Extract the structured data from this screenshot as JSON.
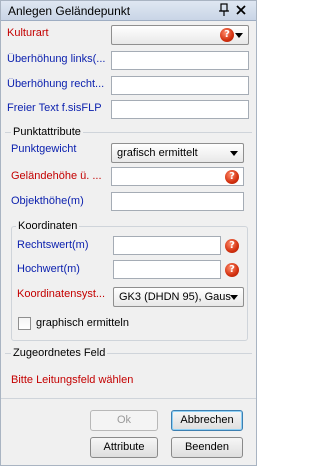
{
  "window": {
    "title": "Anlegen Geländepunkt"
  },
  "titlebar": {
    "pin_icon": "pin-icon",
    "close_icon": "close-icon"
  },
  "form": {
    "kulturart_label": "Kulturart",
    "kulturart_value": "",
    "ueberhoehung_links_label": "Überhöhung links(...",
    "ueberhoehung_links_value": "",
    "ueberhoehung_rechts_label": "Überhöhung recht...",
    "ueberhoehung_rechts_value": "",
    "freier_text_label": "Freier Text f.sisFLP",
    "freier_text_value": ""
  },
  "punktattribute": {
    "title": "Punktattribute",
    "punktgewicht_label": "Punktgewicht",
    "punktgewicht_value": "grafisch ermittelt",
    "gelaendehoehe_label": "Geländehöhe ü. ...",
    "gelaendehoehe_value": "",
    "objekthoehe_label": "Objekthöhe(m)",
    "objekthoehe_value": ""
  },
  "koordinaten": {
    "title": "Koordinaten",
    "rechtswert_label": "Rechtswert(m)",
    "rechtswert_value": "",
    "hochwert_label": "Hochwert(m)",
    "hochwert_value": "",
    "koordinatensystem_label": "Koordinatensyst...",
    "koordinatensystem_value": "GK3 (DHDN 95), Gaus",
    "graphisch_label": "graphisch ermitteln",
    "graphisch_checked": false
  },
  "zugeordnetes_feld": {
    "title": "Zugeordnetes Feld",
    "message": "Bitte Leitungsfeld wählen"
  },
  "buttons": {
    "ok": "Ok",
    "abbrechen": "Abbrechen",
    "attribute": "Attribute",
    "beenden": "Beenden"
  },
  "colors": {
    "label_blue": "#0a1fae",
    "label_red": "#c40000",
    "help_icon": "#d2300f"
  }
}
